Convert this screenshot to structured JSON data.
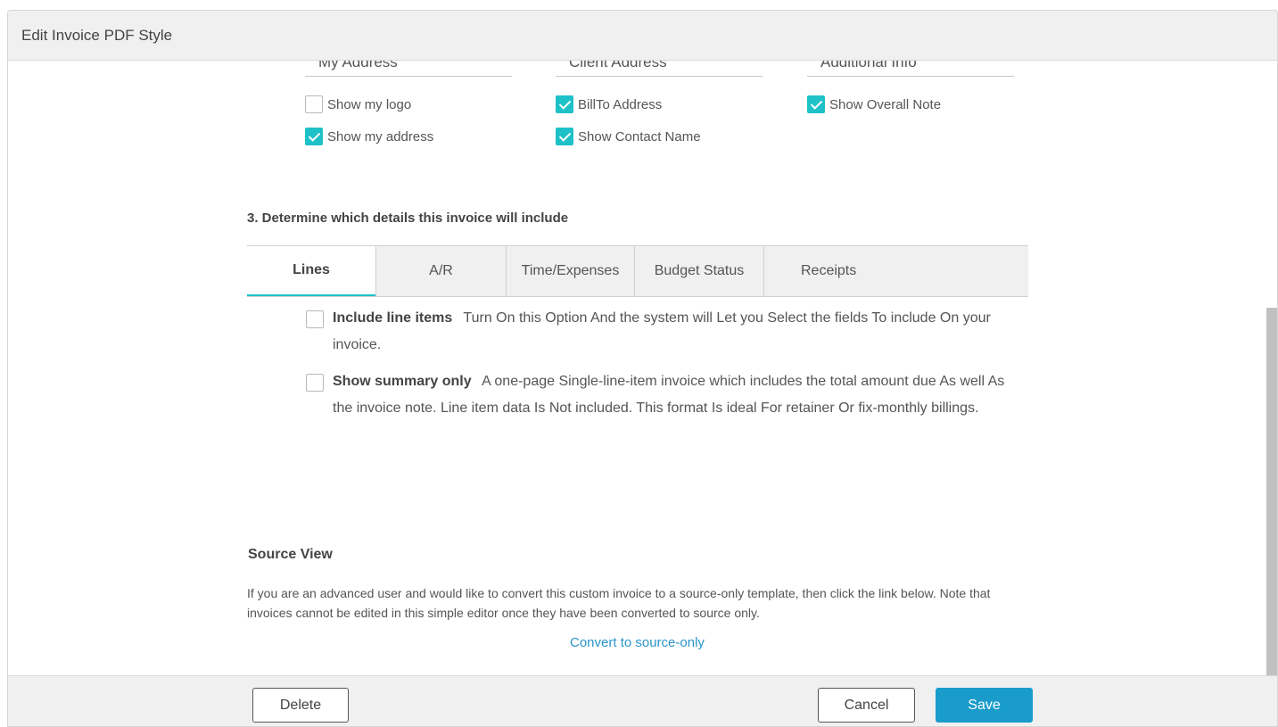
{
  "modal": {
    "title": "Edit Invoice PDF Style"
  },
  "address_columns": [
    {
      "heading": "My Address",
      "options": [
        {
          "label": "Show my logo",
          "checked": false
        },
        {
          "label": "Show my address",
          "checked": true
        }
      ]
    },
    {
      "heading": "Client Address",
      "options": [
        {
          "label": "BillTo Address",
          "checked": true
        },
        {
          "label": "Show Contact Name",
          "checked": true
        }
      ]
    },
    {
      "heading": "Additional Info",
      "options": [
        {
          "label": "Show Overall Note",
          "checked": true
        }
      ]
    }
  ],
  "details_section": {
    "title": "3. Determine which details this invoice will include",
    "tabs": [
      {
        "label": "Lines",
        "active": true
      },
      {
        "label": "A/R",
        "active": false
      },
      {
        "label": "Time/Expenses",
        "active": false
      },
      {
        "label": "Budget Status",
        "active": false
      },
      {
        "label": "Receipts",
        "active": false
      }
    ],
    "line_options": [
      {
        "title": "Include line items",
        "description": "Turn On this Option And the system will Let you Select the fields To include On your invoice.",
        "checked": false
      },
      {
        "title": "Show summary only",
        "description": "A one-page Single-line-item invoice which includes the total amount due As well As the invoice note. Line item data Is Not included. This format Is ideal For retainer Or fix-monthly billings.",
        "checked": false
      }
    ]
  },
  "source_view": {
    "title": "Source View",
    "description": "If you are an advanced user and would like to convert this custom invoice to a source-only template, then click the link below. Note that invoices cannot be edited in this simple editor once they have been converted to source only.",
    "link_label": "Convert to source-only"
  },
  "footer": {
    "delete_label": "Delete",
    "cancel_label": "Cancel",
    "save_label": "Save"
  },
  "colors": {
    "accent": "#1ec1c8",
    "primary_button": "#1a9ccb",
    "link": "#2a93c9"
  }
}
